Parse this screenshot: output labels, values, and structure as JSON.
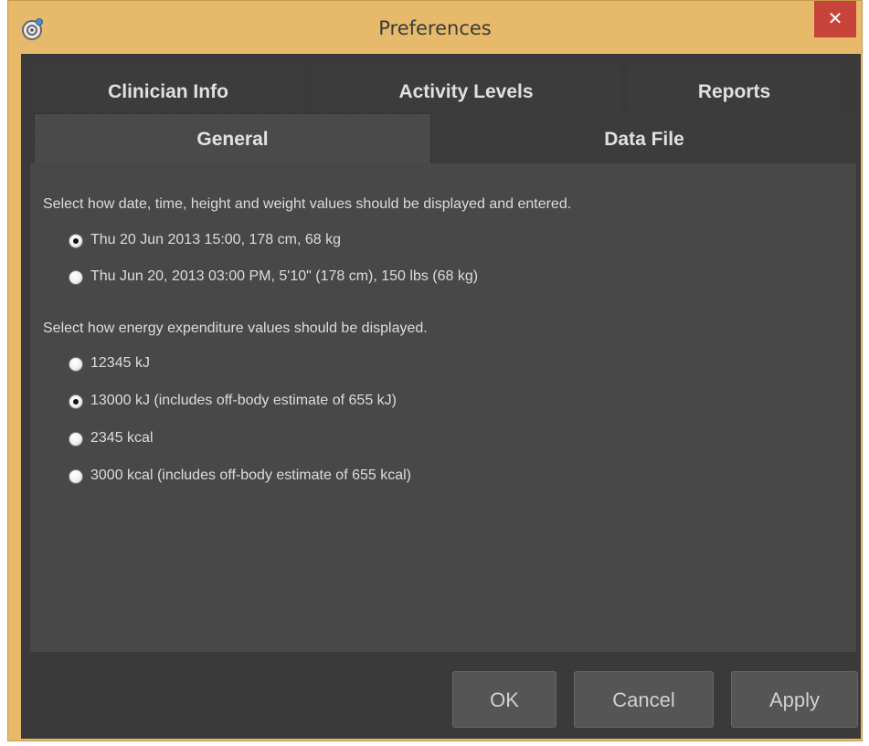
{
  "window": {
    "title": "Preferences",
    "close_label": "✕"
  },
  "tabs": {
    "row1": [
      "Clinician Info",
      "Activity Levels",
      "Reports"
    ],
    "row2": [
      "General",
      "Data File"
    ],
    "active": "General"
  },
  "general": {
    "datetime_prompt": "Select how date, time, height and weight values should be displayed and entered.",
    "datetime_options": [
      {
        "label": "Thu 20 Jun 2013 15:00, 178 cm, 68 kg",
        "checked": true
      },
      {
        "label": "Thu Jun 20, 2013 03:00 PM, 5'10\" (178 cm), 150 lbs (68 kg)",
        "checked": false
      }
    ],
    "energy_prompt": "Select how energy expenditure values should be displayed.",
    "energy_options": [
      {
        "label": "12345 kJ",
        "checked": false
      },
      {
        "label": "13000 kJ (includes off-body estimate of 655 kJ)",
        "checked": true
      },
      {
        "label": "2345 kcal",
        "checked": false
      },
      {
        "label": "3000 kcal (includes off-body estimate of 655 kcal)",
        "checked": false
      }
    ]
  },
  "buttons": {
    "ok": "OK",
    "cancel": "Cancel",
    "apply": "Apply"
  }
}
